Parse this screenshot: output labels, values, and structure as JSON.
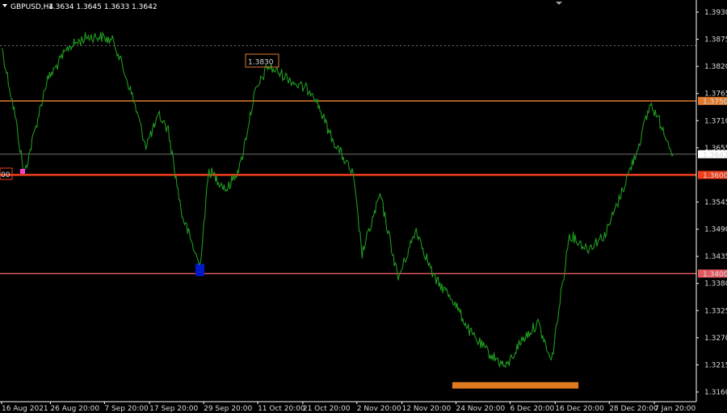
{
  "header": {
    "symbol": "GBPUSD,H4",
    "ohlc": "1.3634 1.3645 1.3633 1.3642"
  },
  "colors": {
    "background": "#000000",
    "price_line": "#1f9a1f",
    "axis": "#ffffff",
    "resistance_orange": "#e07a2e",
    "support_red": "#f0401c",
    "support_pink": "#e25860",
    "current_price_line": "#707070",
    "blue_zone": "#0018c8",
    "orange_zone": "#e07a1e",
    "marker": "#ff3cd2"
  },
  "chart_data": {
    "type": "line",
    "title": "GBPUSD,H4",
    "series": [
      {
        "name": "",
        "x": [
          "16 Aug 2021",
          "19 Aug 2021",
          "21 Aug 2021",
          "26 Aug 2021",
          "31 Aug 2021",
          "4 Sep 2021",
          "7 Sep 2021",
          "10 Sep 2021",
          "14 Sep 2021",
          "17 Sep 2021",
          "20 Sep 2021",
          "22 Sep 2021",
          "25 Sep 2021",
          "29 Sep 2021",
          "1 Oct 2021",
          "5 Oct 2021",
          "8 Oct 2021",
          "11 Oct 2021",
          "14 Oct 2021",
          "18 Oct 2021",
          "21 Oct 2021",
          "24 Oct 2021",
          "28 Oct 2021",
          "2 Nov 2021",
          "4 Nov 2021",
          "8 Nov 2021",
          "12 Nov 2021",
          "16 Nov 2021",
          "20 Nov 2021",
          "24 Nov 2021",
          "28 Nov 2021",
          "2 Dec 2021",
          "6 Dec 2021",
          "9 Dec 2021",
          "13 Dec 2021",
          "16 Dec 2021",
          "20 Dec 2021",
          "24 Dec 2021",
          "28 Dec 2021",
          "31 Dec 2021",
          "4 Jan 2022",
          "7 Jan 2022",
          "10 Jan 2022",
          "12 Jan 2022"
        ],
        "y": [
          1.386,
          1.372,
          1.36,
          1.379,
          1.386,
          1.388,
          1.388,
          1.387,
          1.376,
          1.366,
          1.372,
          1.369,
          1.352,
          1.3415,
          1.361,
          1.357,
          1.362,
          1.376,
          1.382,
          1.38,
          1.378,
          1.377,
          1.368,
          1.36,
          1.344,
          1.356,
          1.339,
          1.349,
          1.339,
          1.335,
          1.328,
          1.324,
          1.321,
          1.326,
          1.33,
          1.322,
          1.348,
          1.345,
          1.348,
          1.355,
          1.365,
          1.3745,
          1.369,
          1.3642
        ]
      }
    ],
    "x_tick_labels": [
      "16 Aug 2021",
      "26 Aug 20:00",
      "7 Sep 20:00",
      "17 Sep 20:00",
      "29 Sep 20:00",
      "11 Oct 20:00",
      "21 Oct 20:00",
      "2 Nov 20:00",
      "12 Nov 20:00",
      "24 Nov 20:00",
      "6 Dec 20:00",
      "16 Dec 20:00",
      "28 Dec 20:00",
      "7 Jan 20:00"
    ],
    "y_tick_labels": [
      "1.3930",
      "1.3875",
      "1.3820",
      "1.3765",
      "1.3710",
      "1.3655",
      "1.3545",
      "1.3490",
      "1.3435",
      "1.3380",
      "1.3325",
      "1.3270",
      "1.3215",
      "1.3160"
    ],
    "ylim": [
      1.315,
      1.394
    ],
    "horizontal_levels": [
      {
        "value": 1.375,
        "label": "1.3750",
        "color": "#e07a2e"
      },
      {
        "value": 1.36,
        "label": "1.3600",
        "color": "#f0401c"
      },
      {
        "value": 1.34,
        "label": "1.3400",
        "color": "#e25860"
      }
    ],
    "current_price": {
      "value": 1.3642,
      "label": "1.3642"
    },
    "dotted_level": 1.3862,
    "annotations": [
      {
        "text": "1.3830",
        "color": "#e07a2e"
      },
      {
        "text": "00",
        "color": "#f0401c"
      }
    ],
    "zones": [
      {
        "name": "blue-zone",
        "x_from": "28 Sep 2021",
        "x_to": "30 Sep 2021",
        "y_from": 1.3395,
        "y_to": 1.342,
        "color": "#0018c8"
      },
      {
        "name": "orange-zone",
        "x_from": "24 Nov 2021",
        "x_to": "22 Dec 2021",
        "y_from": 1.317,
        "y_to": 1.318,
        "color": "#e07a1e"
      }
    ],
    "grid": false
  }
}
